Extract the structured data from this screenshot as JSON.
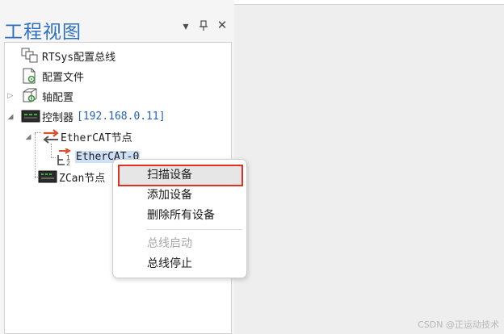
{
  "panel": {
    "title": "工程视图",
    "dropdown_glyph": "▾",
    "pin_glyph": "⊥",
    "close_glyph": "✕"
  },
  "tree": {
    "items": [
      {
        "label": "RTSys配置总线",
        "icon": "rtsys-bus-icon"
      },
      {
        "label": "配置文件",
        "icon": "config-file-icon"
      },
      {
        "label": "轴配置",
        "icon": "axis-config-icon",
        "expander": "▷"
      },
      {
        "label": "控制器",
        "ip": "[192.168.0.11]",
        "icon": "controller-icon",
        "expander": "◢"
      },
      {
        "label": "EtherCAT节点",
        "icon": "ethercat-node-icon",
        "expander": "◢"
      },
      {
        "label": "EtherCAT-0",
        "icon": "ethercat-slot-icon",
        "selected": true
      },
      {
        "label": "ZCan节点",
        "icon": "zcan-node-icon"
      }
    ]
  },
  "context_menu": {
    "items": [
      {
        "label": "扫描设备",
        "highlighted": true
      },
      {
        "label": "添加设备"
      },
      {
        "label": "删除所有设备"
      },
      {
        "label": "总线启动",
        "disabled": true
      },
      {
        "label": "总线停止"
      }
    ]
  },
  "watermark": "CSDN @正运动技术",
  "colors": {
    "title_blue": "#2f6fc0",
    "ip_blue": "#2460b8",
    "highlight_border": "#e0301e",
    "selection": "#cde0f7"
  }
}
